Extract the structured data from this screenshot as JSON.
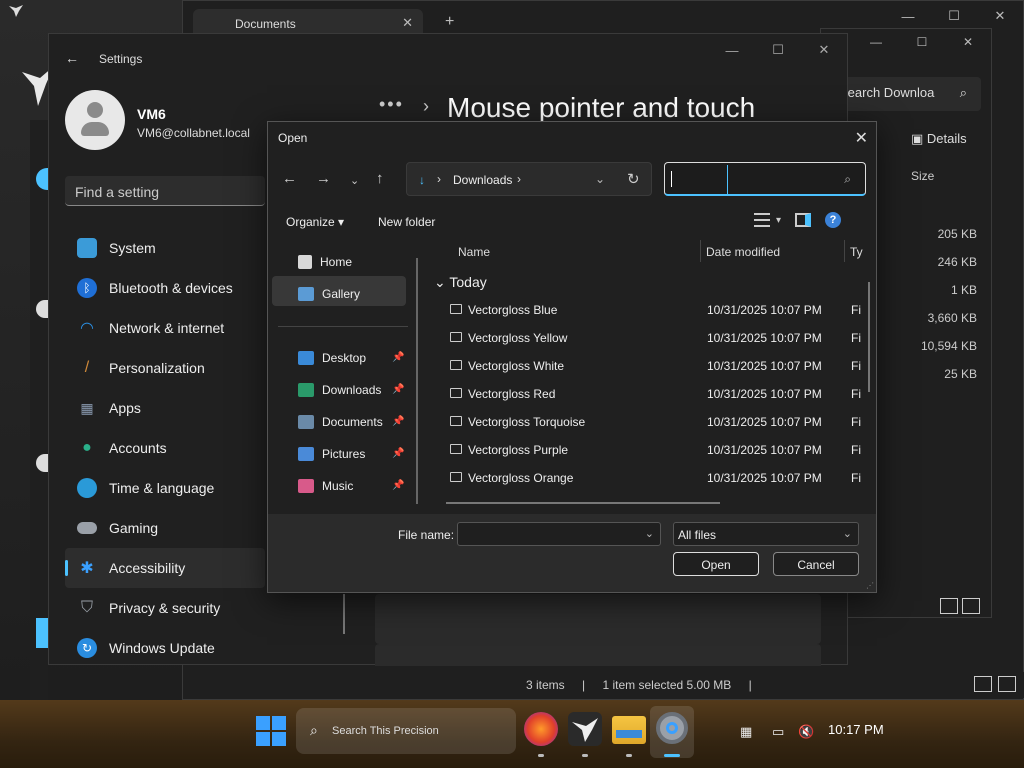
{
  "explorer": {
    "tab_title": "Documents",
    "search_placeholder": "Search Downloa",
    "details_label": "Details",
    "size_header": "Size",
    "sizes": [
      "205 KB",
      "246 KB",
      "1 KB",
      "3,660 KB",
      "10,594 KB",
      "25 KB"
    ],
    "status": {
      "items": "3 items",
      "selected": "1 item selected  5.00 MB"
    }
  },
  "settings": {
    "title": "Settings",
    "user_name": "VM6",
    "user_email": "VM6@collabnet.local",
    "find_placeholder": "Find a setting",
    "page_title": "Mouse pointer and touch",
    "nav": [
      {
        "label": "System",
        "icon": "system-icon",
        "color": "#3b9bd8"
      },
      {
        "label": "Bluetooth & devices",
        "icon": "bluetooth-icon",
        "color": "#1f6fd6"
      },
      {
        "label": "Network & internet",
        "icon": "wifi-icon",
        "color": "#2a8de0"
      },
      {
        "label": "Personalization",
        "icon": "brush-icon",
        "color": "#d08a3a"
      },
      {
        "label": "Apps",
        "icon": "apps-icon",
        "color": "#8a9ab0"
      },
      {
        "label": "Accounts",
        "icon": "accounts-icon",
        "color": "#2ab08a"
      },
      {
        "label": "Time & language",
        "icon": "globe-icon",
        "color": "#2a9ad8"
      },
      {
        "label": "Gaming",
        "icon": "gamepad-icon",
        "color": "#9aa0a8"
      },
      {
        "label": "Accessibility",
        "icon": "accessibility-icon",
        "color": "#3aa0ff"
      },
      {
        "label": "Privacy & security",
        "icon": "shield-icon",
        "color": "#9aa0a8"
      },
      {
        "label": "Windows Update",
        "icon": "update-icon",
        "color": "#2a8de0"
      }
    ]
  },
  "dialog": {
    "title": "Open",
    "address": "Downloads",
    "organize_label": "Organize",
    "new_folder_label": "New folder",
    "side_items": [
      {
        "label": "Home",
        "icon": "home-icon"
      },
      {
        "label": "Gallery",
        "icon": "gallery-icon"
      },
      {
        "label": "Desktop",
        "icon": "desktop-icon"
      },
      {
        "label": "Downloads",
        "icon": "downloads-icon"
      },
      {
        "label": "Documents",
        "icon": "documents-icon"
      },
      {
        "label": "Pictures",
        "icon": "pictures-icon"
      },
      {
        "label": "Music",
        "icon": "music-icon"
      }
    ],
    "columns": {
      "name": "Name",
      "date": "Date modified",
      "type": "Ty"
    },
    "group": "Today",
    "files": [
      {
        "name": "Vectorgloss Blue",
        "date": "10/31/2025 10:07 PM",
        "type": "Fi"
      },
      {
        "name": "Vectorgloss Yellow",
        "date": "10/31/2025 10:07 PM",
        "type": "Fi"
      },
      {
        "name": "Vectorgloss White",
        "date": "10/31/2025 10:07 PM",
        "type": "Fi"
      },
      {
        "name": "Vectorgloss Red",
        "date": "10/31/2025 10:07 PM",
        "type": "Fi"
      },
      {
        "name": "Vectorgloss Torquoise",
        "date": "10/31/2025 10:07 PM",
        "type": "Fi"
      },
      {
        "name": "Vectorgloss Purple",
        "date": "10/31/2025 10:07 PM",
        "type": "Fi"
      },
      {
        "name": "Vectorgloss Orange",
        "date": "10/31/2025 10:07 PM",
        "type": "Fi"
      }
    ],
    "file_name_label": "File name:",
    "file_name_value": "",
    "filter": "All files",
    "open_label": "Open",
    "cancel_label": "Cancel"
  },
  "taskbar": {
    "search_text": "Search This Precision",
    "clock": "10:17 PM"
  }
}
